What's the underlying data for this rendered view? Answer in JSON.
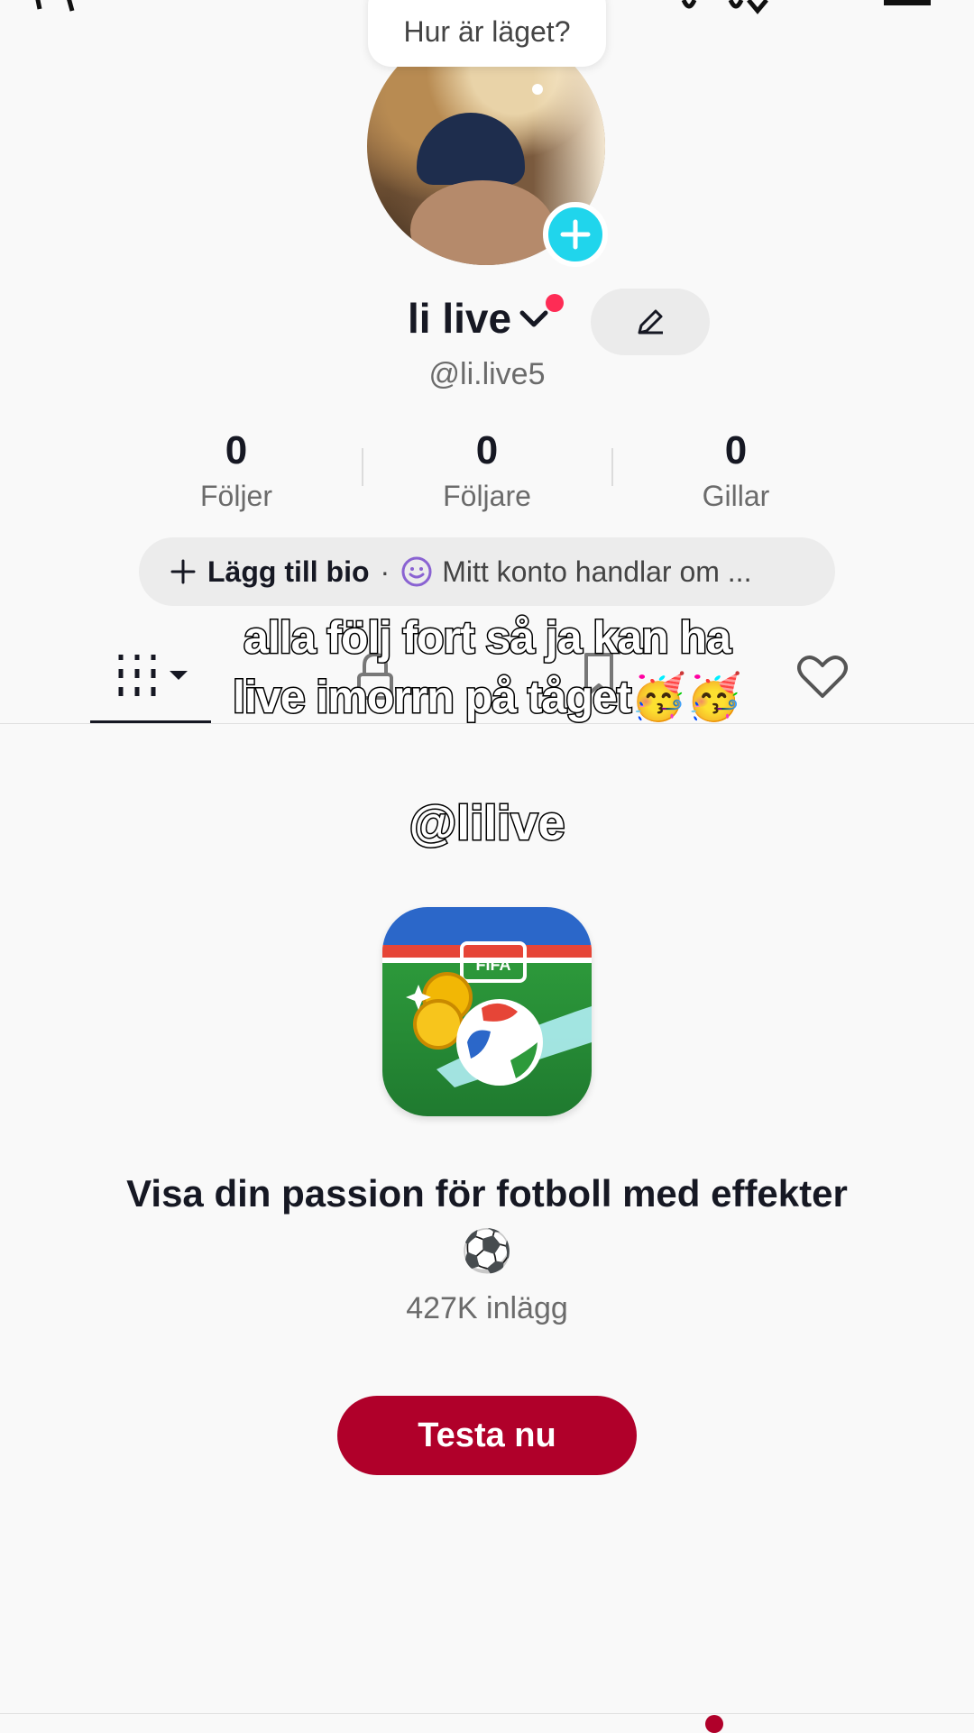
{
  "bubble": {
    "text": "Hur är läget?"
  },
  "profile": {
    "name": "li live",
    "handle": "@li.live5"
  },
  "stats": [
    {
      "value": "0",
      "label": "Följer"
    },
    {
      "value": "0",
      "label": "Följare"
    },
    {
      "value": "0",
      "label": "Gillar"
    }
  ],
  "bio": {
    "add_label": "Lägg till bio",
    "separator": "·",
    "suggestion": "Mitt konto handlar om ..."
  },
  "tabs": [
    {
      "icon": "grid-icon",
      "selected": true
    },
    {
      "icon": "lock-icon",
      "selected": false
    },
    {
      "icon": "bookmark-icon",
      "selected": false
    },
    {
      "icon": "heart-icon",
      "selected": false
    }
  ],
  "overlay": {
    "caption_line1": "alla följ fort så ja kan ha",
    "caption_line2": "live imorrn på tåget🥳🥳",
    "tag": "@lilive"
  },
  "effect": {
    "badge": "FIFA",
    "title": "Visa din passion för fotboll med effekter",
    "emoji": "⚽",
    "count": "427K inlägg",
    "button": "Testa nu"
  },
  "colors": {
    "accent_cyan": "#20d5ec",
    "notification_red": "#fe2c55",
    "button_red": "#b0002a",
    "background": "#f9f9f9"
  }
}
